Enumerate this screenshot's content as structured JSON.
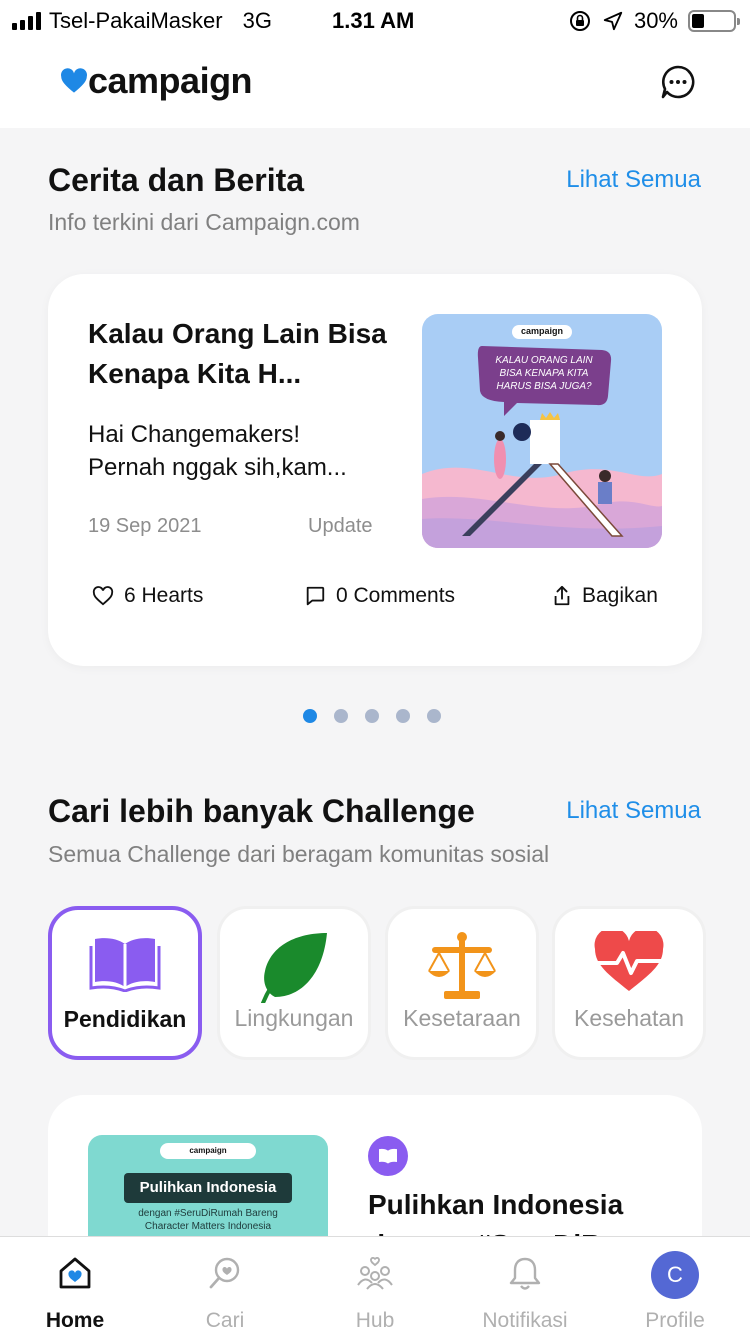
{
  "status_bar": {
    "carrier": "Tsel-PakaiMasker",
    "network": "3G",
    "time": "1.31 AM",
    "battery": "30%",
    "battery_level": 0.3
  },
  "header": {
    "logo_text": "campaign",
    "brand_color": "#1e88e5",
    "chat_icon": "chat-bubble-icon"
  },
  "stories": {
    "title": "Cerita dan Berita",
    "subtitle": "Info terkini dari Campaign.com",
    "see_all": "Lihat Semua",
    "card": {
      "title": "Kalau Orang Lain Bisa Kenapa Kita H...",
      "excerpt": "Hai Changemakers! Pernah nggak sih,kam...",
      "date": "19 Sep 2021",
      "tag": "Update",
      "image": {
        "brand": "campaign",
        "bubble_text": "KALAU ORANG LAIN BISA KENAPA KITA HARUS BISA JUGA?"
      },
      "hearts": "6 Hearts",
      "comments": "0 Comments",
      "share": "Bagikan"
    },
    "pagination": {
      "total": 5,
      "active": 1
    }
  },
  "challenges": {
    "title": "Cari lebih banyak Challenge",
    "subtitle": "Semua Challenge dari beragam komunitas sosial",
    "see_all": "Lihat Semua",
    "categories": [
      {
        "label": "Pendidikan",
        "icon": "book-icon",
        "color": "#8a5cf0",
        "active": true
      },
      {
        "label": "Lingkungan",
        "icon": "leaf-icon",
        "color": "#1a8a2c",
        "active": false
      },
      {
        "label": "Kesetaraan",
        "icon": "scale-icon",
        "color": "#f2941a",
        "active": false
      },
      {
        "label": "Kesehatan",
        "icon": "heart-pulse-icon",
        "color": "#ee4a4a",
        "active": false
      }
    ],
    "card": {
      "image_brand": "campaign",
      "image_title": "Pulihkan Indonesia",
      "image_subtitle": "dengan #SeruDiRumah Bareng Character Matters Indonesia",
      "title": "Pulihkan Indonesia dengan #SeruDiR..."
    }
  },
  "tabbar": {
    "items": [
      {
        "label": "Home",
        "icon": "home-icon",
        "active": true
      },
      {
        "label": "Cari",
        "icon": "search-icon",
        "active": false
      },
      {
        "label": "Hub",
        "icon": "people-icon",
        "active": false
      },
      {
        "label": "Notifikasi",
        "icon": "bell-icon",
        "active": false
      },
      {
        "label": "Profile",
        "icon": "avatar-icon",
        "active": false
      }
    ],
    "avatar_initial": "C"
  }
}
